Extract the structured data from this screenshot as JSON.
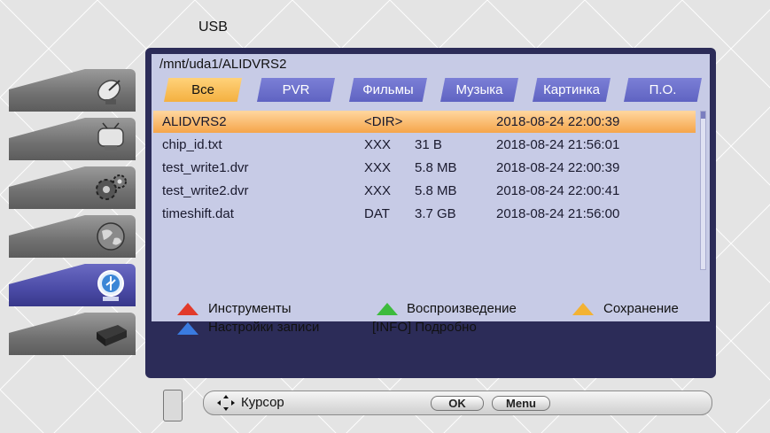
{
  "section_title": "USB",
  "path": "/mnt/uda1/ALIDVRS2",
  "tabs": [
    {
      "label": "Все"
    },
    {
      "label": "PVR"
    },
    {
      "label": "Фильмы"
    },
    {
      "label": "Музыка"
    },
    {
      "label": "Картинка"
    },
    {
      "label": "П.О."
    }
  ],
  "active_tab": "Все",
  "files": [
    {
      "name": "ALIDVRS2",
      "type": "<DIR>",
      "size": "",
      "date": "2018-08-24 22:00:39"
    },
    {
      "name": "chip_id.txt",
      "type": "XXX",
      "size": "31 B",
      "date": "2018-08-24 21:56:01"
    },
    {
      "name": "test_write1.dvr",
      "type": "XXX",
      "size": "5.8 MB",
      "date": "2018-08-24 22:00:39"
    },
    {
      "name": "test_write2.dvr",
      "type": "XXX",
      "size": "5.8 MB",
      "date": "2018-08-24 22:00:41"
    },
    {
      "name": "timeshift.dat",
      "type": "DAT",
      "size": "3.7 GB",
      "date": "2018-08-24 21:56:00"
    }
  ],
  "selected_file": "ALIDVRS2",
  "legend": {
    "red": "Инструменты",
    "green": "Воспроизведение",
    "yellow": "Сохранение",
    "blue": "Настройки записи",
    "info": "[INFO] Подробно"
  },
  "bottom_bar": {
    "cursor_label": "Курсор",
    "ok_label": "OK",
    "menu_label": "Menu"
  },
  "menu_items": [
    {
      "icon": "satellite-dish-icon",
      "active": false
    },
    {
      "icon": "tv-icon",
      "active": false
    },
    {
      "icon": "gears-icon",
      "active": false
    },
    {
      "icon": "globe-icon",
      "active": false
    },
    {
      "icon": "usb-icon",
      "active": true
    },
    {
      "icon": "set-top-box-icon",
      "active": false
    }
  ],
  "colors": {
    "panel_bg": "#2c2c58",
    "panel_inner": "#c7cbe6",
    "tab_blue": "#6a6ec8",
    "tab_active": "#f8c25a",
    "row_selected": "#f5a54a",
    "menu_active": "#4b4ba6",
    "key_red": "#e23a2a",
    "key_green": "#3dbb3d",
    "key_yellow": "#f3b233",
    "key_blue": "#3a7be0"
  }
}
